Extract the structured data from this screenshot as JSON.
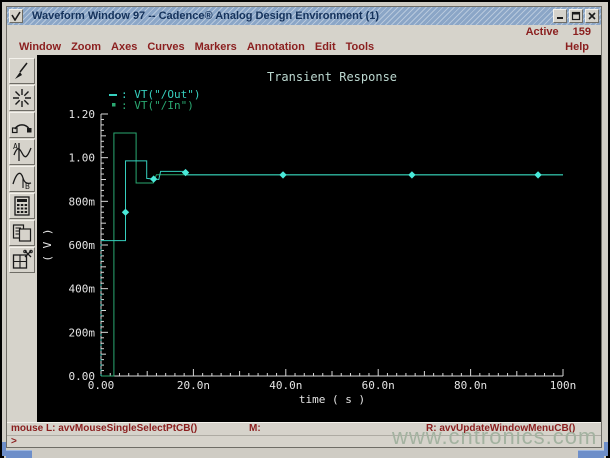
{
  "window": {
    "title": "Waveform Window 97 -- Cadence® Analog Design Environment (1)"
  },
  "header": {
    "active_label": "Active",
    "active_count": "159"
  },
  "menu": {
    "items": [
      "Window",
      "Zoom",
      "Axes",
      "Curves",
      "Markers",
      "Annotation",
      "Edit",
      "Tools"
    ],
    "help_label": "Help"
  },
  "toolbar": {
    "tools": [
      "brush-tool",
      "zoom-fit-tool",
      "curve-tool",
      "vertical-marker-tool",
      "horizontal-marker-tool",
      "calculator-tool",
      "copy-window-tool",
      "cut-window-tool"
    ]
  },
  "chart_data": {
    "type": "line",
    "title": "Transient Response",
    "xlabel": "time ( s )",
    "ylabel": "( V )",
    "xlim_ns": [
      0,
      100
    ],
    "ylim": [
      0,
      1.2
    ],
    "grid": false,
    "background": "#000000",
    "axis_color": "#d8d8d8",
    "title_color": "#bcd8d0",
    "x_ticks": [
      {
        "t": 0,
        "label": "0.00"
      },
      {
        "t": 20,
        "label": "20.0n"
      },
      {
        "t": 40,
        "label": "40.0n"
      },
      {
        "t": 60,
        "label": "60.0n"
      },
      {
        "t": 80,
        "label": "80.0n"
      },
      {
        "t": 100,
        "label": "100n"
      }
    ],
    "y_ticks": [
      {
        "v": 0,
        "label": "0.00"
      },
      {
        "v": 0.2,
        "label": "200m"
      },
      {
        "v": 0.4,
        "label": "400m"
      },
      {
        "v": 0.6,
        "label": "600m"
      },
      {
        "v": 0.8,
        "label": "800m"
      },
      {
        "v": 1.0,
        "label": "1.00"
      },
      {
        "v": 1.2,
        "label": "1.20"
      }
    ],
    "series": [
      {
        "name": "VT(\"/Out\")",
        "color": "#36cfbe",
        "sample": "dash",
        "points": [
          [
            0,
            0.62
          ],
          [
            5.3,
            0.62
          ],
          [
            5.3,
            0.985
          ],
          [
            9.9,
            0.985
          ],
          [
            9.9,
            0.905
          ],
          [
            12.5,
            0.9
          ],
          [
            12.9,
            0.937
          ],
          [
            18.2,
            0.937
          ],
          [
            18.5,
            0.921
          ],
          [
            100,
            0.921
          ]
        ],
        "dash_points": [
          [
            0,
            0
          ],
          [
            0,
            0.62
          ]
        ],
        "markers": [
          [
            5.3,
            0.75
          ],
          [
            11.4,
            0.902
          ],
          [
            18.3,
            0.932
          ],
          [
            39.4,
            0.921
          ],
          [
            67.3,
            0.921
          ],
          [
            94.6,
            0.921
          ]
        ],
        "marker_color": "#49e8d8"
      },
      {
        "name": "VT(\"/In\")",
        "color": "#2aa871",
        "sample": "dot",
        "points": [
          [
            0,
            0
          ],
          [
            2.8,
            0
          ],
          [
            2.8,
            1.113
          ],
          [
            7.6,
            1.113
          ],
          [
            7.6,
            0.884
          ],
          [
            11.3,
            0.884
          ],
          [
            12.0,
            0.922
          ],
          [
            100,
            0.922
          ]
        ],
        "dash_points": [],
        "markers": [],
        "marker_color": "#2aa871"
      }
    ]
  },
  "statusbar": {
    "left": "mouse L: avvMouseSingleSelectPtCB()",
    "middle": "M:",
    "right": "R: avvUpdateWindowMenuCB()",
    "prompt": ">"
  },
  "watermark": {
    "text": "www.cntronics.com"
  }
}
